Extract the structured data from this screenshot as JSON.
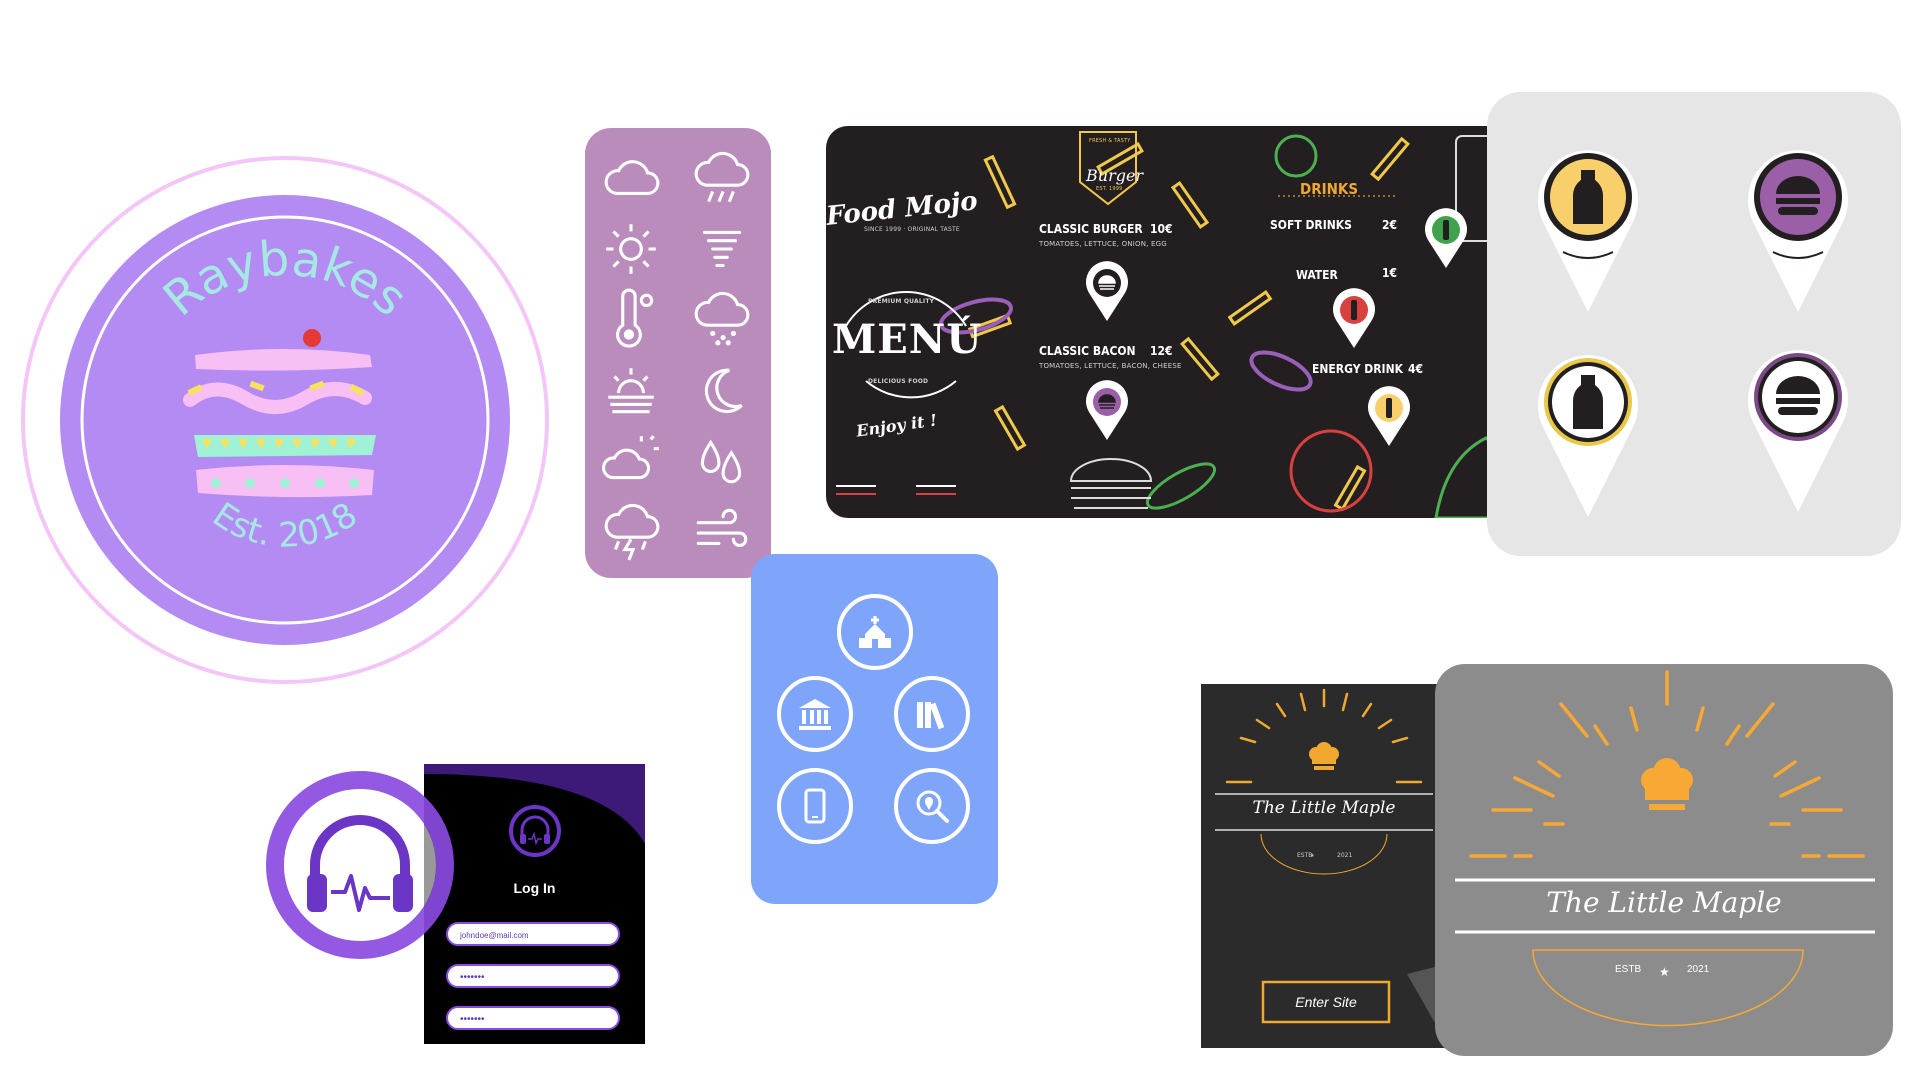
{
  "raybakes": {
    "brand": "Raybakes",
    "established": "Est. 2018",
    "colors": {
      "outer_ring": "#f4c6f7",
      "disk": "#b38bf3",
      "text": "#a5e8e4"
    }
  },
  "weather_panel": {
    "background": "#b98cbc",
    "icons": [
      "cloud-icon",
      "cloud-rain-icon",
      "sun-icon",
      "tornado-icon",
      "thermometer-icon",
      "cloud-snow-icon",
      "sunrise-icon",
      "moon-icon",
      "partly-cloudy-icon",
      "droplets-icon",
      "thunderstorm-icon",
      "wind-icon"
    ]
  },
  "menu_board": {
    "brand": "Food Mojo",
    "brand_tagline": "SINCE 1999 · ORIGINAL TASTE",
    "menu_title": "MENÚ",
    "premium": "PREMIUM QUALITY",
    "delicious": "DELICIOUS FOOD",
    "enjoy": "Enjoy it !",
    "burger_badge": "Burger",
    "burger_badge_top": "FRESH & TASTY",
    "burger_badge_bottom": "EST. 1999",
    "items": [
      {
        "name": "CLASSIC BURGER",
        "price": "10€",
        "desc": "TOMATOES, LETTUCE, ONION, EGG"
      },
      {
        "name": "CLASSIC BACON",
        "price": "12€",
        "desc": "TOMATOES, LETTUCE, BACON, CHEESE"
      }
    ],
    "drinks_title": "DRINKS",
    "drinks": [
      {
        "name": "SOFT DRINKS",
        "price": "2€"
      },
      {
        "name": "WATER",
        "price": "1€"
      },
      {
        "name": "ENERGY DRINK",
        "price": "4€"
      }
    ]
  },
  "pins_panel": {
    "pins": [
      {
        "icon": "bottle-icon",
        "ring_color": "#231f20",
        "fill_color": "#f9cf6b"
      },
      {
        "icon": "burger-icon",
        "ring_color": "#231f20",
        "fill_color": "#9b5fa7"
      },
      {
        "icon": "bottle-icon",
        "ring_color": "#e8c84a",
        "fill_color": "#ffffff"
      },
      {
        "icon": "burger-icon",
        "ring_color": "#7b4a86",
        "fill_color": "#ffffff"
      }
    ]
  },
  "places_panel": {
    "background": "#7fa5fb",
    "icons": [
      "church-icon",
      "museum-icon",
      "library-icon",
      "phone-icon",
      "search-location-icon"
    ]
  },
  "music_login": {
    "title": "Log In",
    "email_value": "johndoe@mail.com",
    "password_mask": "•••••••",
    "confirm_mask": "•••••••",
    "accent": "#8a4be0"
  },
  "little_maple_small": {
    "name": "The Little Maple",
    "estb": "ESTB",
    "year": "2021",
    "enter": "Enter Site",
    "accent": "#f0a830"
  },
  "little_maple_large": {
    "name": "The Little Maple",
    "estb": "ESTB",
    "year": "2021",
    "accent": "#f7a835"
  }
}
